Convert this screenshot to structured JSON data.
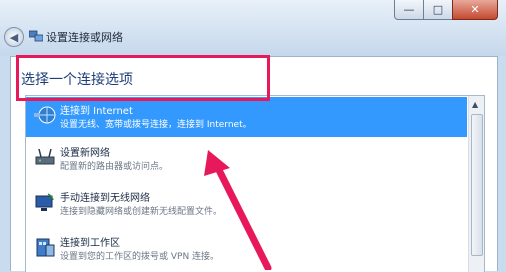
{
  "window": {
    "title": "设置连接或网络",
    "controls": {
      "minimize": "—",
      "maximize": "□",
      "close": "✕"
    },
    "back_icon": "back-arrow-icon"
  },
  "main": {
    "heading": "选择一个连接选项",
    "options": [
      {
        "title": "连接到 Internet",
        "description": "设置无线、宽带或拨号连接，连接到 Internet。",
        "selected": true,
        "icon": "internet-globe-icon"
      },
      {
        "title": "设置新网络",
        "description": "配置新的路由器或访问点。",
        "selected": false,
        "icon": "router-icon"
      },
      {
        "title": "手动连接到无线网络",
        "description": "连接到隐藏网络或创建新无线配置文件。",
        "selected": false,
        "icon": "wireless-computer-icon"
      },
      {
        "title": "连接到工作区",
        "description": "设置到您的工作区的拨号或 VPN 连接。",
        "selected": false,
        "icon": "workplace-building-icon"
      }
    ]
  },
  "annotation": {
    "highlight_color": "#e8195a",
    "arrow_color": "#e8195a"
  },
  "colors": {
    "selection": "#3399ff",
    "heading": "#1e3f7a"
  }
}
